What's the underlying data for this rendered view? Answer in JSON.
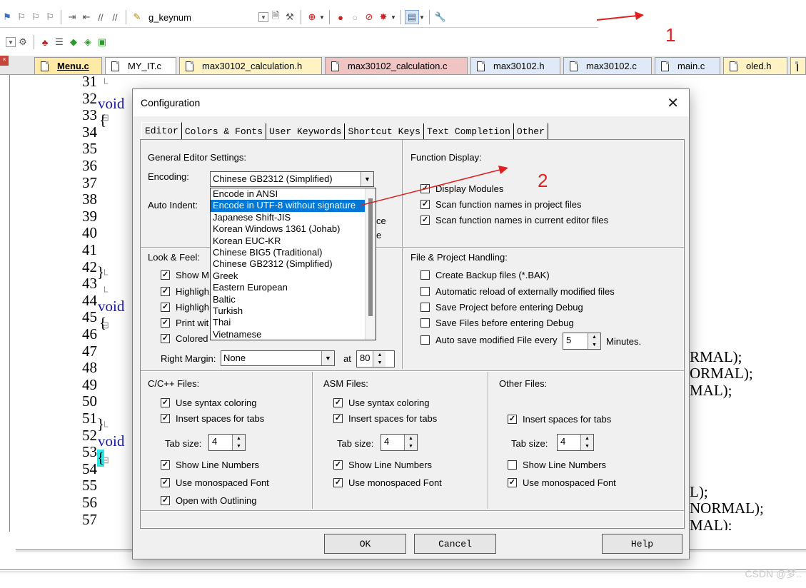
{
  "toolbar": {
    "search_value": "g_keynum"
  },
  "tabs": [
    {
      "label": "Menu.c",
      "color": "#ffe9a6",
      "active": true
    },
    {
      "label": "MY_IT.c",
      "color": "#ffffff"
    },
    {
      "label": "max30102_calculation.h",
      "color": "#fff3c4"
    },
    {
      "label": "max30102_calculation.c",
      "color": "#f1c4c4"
    },
    {
      "label": "max30102.h",
      "color": "#dfe9f7"
    },
    {
      "label": "max30102.c",
      "color": "#dfe9f7"
    },
    {
      "label": "main.c",
      "color": "#dfe9f7"
    },
    {
      "label": "oled.h",
      "color": "#fff3c4"
    }
  ],
  "code": {
    "line_numbers": [
      "31",
      "32",
      "33",
      "34",
      "35",
      "36",
      "37",
      "38",
      "39",
      "40",
      "41",
      "42",
      "43",
      "44",
      "45",
      "46",
      "47",
      "48",
      "49",
      "50",
      "51",
      "52",
      "53",
      "54",
      "55",
      "56",
      "57"
    ],
    "kw_void": "void",
    "brace_open": "{",
    "brace_close": "}",
    "r47": "RMAL);",
    "r48": "ORMAL);",
    "r49": "MAL);",
    "r55": "L);",
    "r56": "NORMAL);",
    "r57": "MAL);"
  },
  "dialog": {
    "title": "Configuration",
    "tabs": [
      "Editor",
      "Colors & Fonts",
      "User Keywords",
      "Shortcut Keys",
      "Text Completion",
      "Other"
    ],
    "general": {
      "title": "General Editor Settings:",
      "encoding_label": "Encoding:",
      "encoding_value": "Chinese GB2312 (Simplified)",
      "auto_indent_label": "Auto Indent:",
      "hidden_ce": "ce",
      "hidden_e": "e"
    },
    "encoding_options": [
      "Encode in ANSI",
      "Encode in UTF-8 without signature",
      "Japanese Shift-JIS",
      "Korean Windows 1361 (Johab)",
      "Korean EUC-KR",
      "Chinese BIG5 (Traditional)",
      "Chinese GB2312 (Simplified)",
      "Greek",
      "Eastern European",
      "Baltic",
      "Turkish",
      "Thai",
      "Vietnamese"
    ],
    "function_display": {
      "title": "Function Display:",
      "display_modules": "Display Modules",
      "scan_project": "Scan function names in project files",
      "scan_editor": "Scan function names in current editor files"
    },
    "look_feel": {
      "title": "Look & Feel:",
      "items": [
        "Show M",
        "Highligh",
        "Highligh",
        "Print wit",
        "Colored"
      ],
      "right_margin_label": "Right Margin:",
      "right_margin_value": "None",
      "at_label": "at",
      "at_value": "80"
    },
    "file_project": {
      "title": "File & Project Handling:",
      "backup": "Create Backup files (*.BAK)",
      "reload": "Automatic reload of externally modified files",
      "save_project": "Save Project before entering Debug",
      "save_files": "Save Files before entering Debug",
      "autosave": "Auto save modified File every",
      "autosave_value": "5",
      "minutes": "Minutes."
    },
    "cpp": {
      "title": "C/C++ Files:",
      "syntax": "Use syntax coloring",
      "spaces": "Insert spaces for tabs",
      "tab_size_label": "Tab size:",
      "tab_size": "4",
      "line_numbers": "Show Line Numbers",
      "mono": "Use monospaced Font",
      "outlining": "Open with Outlining"
    },
    "asm": {
      "title": "ASM Files:",
      "syntax": "Use syntax coloring",
      "spaces": "Insert spaces for tabs",
      "tab_size_label": "Tab size:",
      "tab_size": "4",
      "line_numbers": "Show Line Numbers",
      "mono": "Use monospaced Font"
    },
    "other": {
      "title": "Other Files:",
      "spaces": "Insert spaces for tabs",
      "tab_size_label": "Tab size:",
      "tab_size": "4",
      "line_numbers": "Show Line Numbers",
      "mono": "Use monospaced Font"
    },
    "buttons": {
      "ok": "OK",
      "cancel": "Cancel",
      "help": "Help"
    }
  },
  "annotations": {
    "one": "1",
    "two": "2",
    "color": "#e02020"
  },
  "watermark": "CSDN @梦.."
}
